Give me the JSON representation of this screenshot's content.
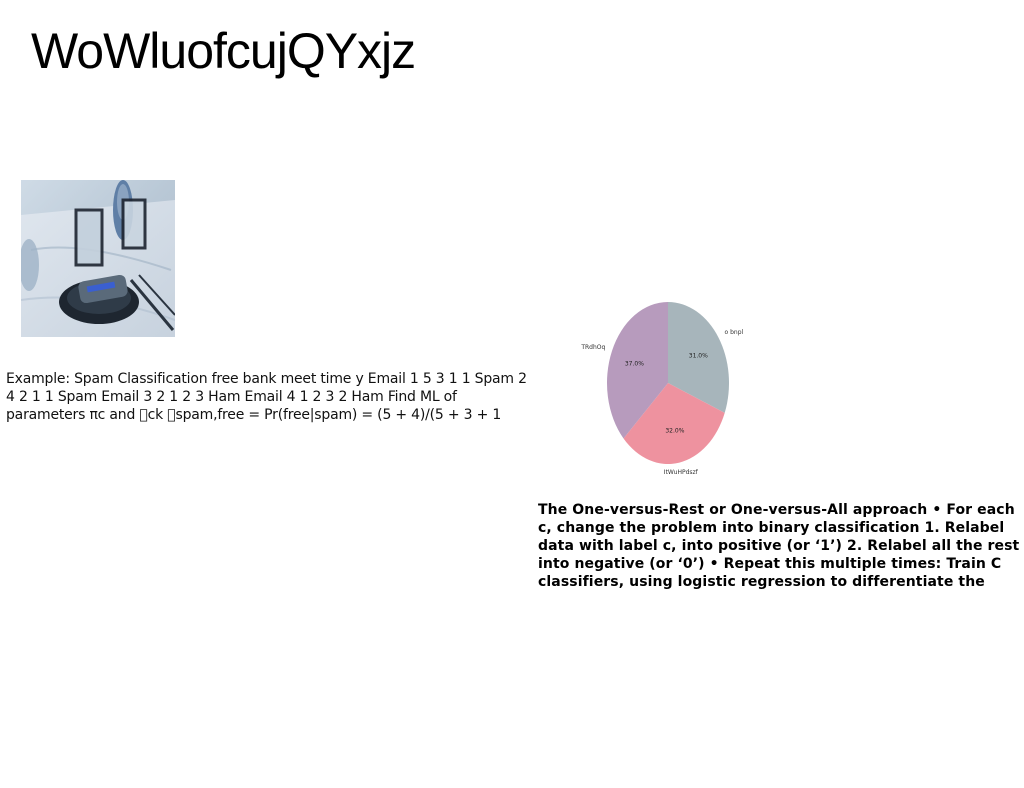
{
  "title": "WoWluofcujQYxjz",
  "photo": {
    "icon": "table-setting-photo"
  },
  "left_text": "Example: Spam Classification free bank meet time y Email 1 5 3 1 1 Spam 2 4 2 1 1 Spam Email 3 2 1 2 3 Ham Email 4 1 2 3 2 Ham Find ML of parameters πc and \u0000ck \u0000spam,free = Pr(free|spam) = (5 + 4)/(5 + 3 + 1",
  "right_text": "The One-versus-Rest or One-versus-All approach • For each c, change the problem into binary classification 1. Relabel data with label c, into positive (or ‘1’) 2. Relabel all the rest into negative (or ‘0’) • Repeat this multiple times: Train C classifiers, using logistic regression to differentiate the",
  "chart_data": {
    "type": "pie",
    "title": "",
    "legend": "none",
    "start_angle": 90,
    "direction": "clockwise",
    "slices": [
      {
        "label": "o bnpl",
        "value": 31.0,
        "display": "31.0%",
        "color": "#a7b5bb"
      },
      {
        "label": "JtWuHPdszf",
        "value": 32.0,
        "display": "32.0%",
        "color": "#ee929f"
      },
      {
        "label": "TRdhOq",
        "value": 37.0,
        "display": "37.0%",
        "color": "#b79bbd"
      }
    ]
  }
}
